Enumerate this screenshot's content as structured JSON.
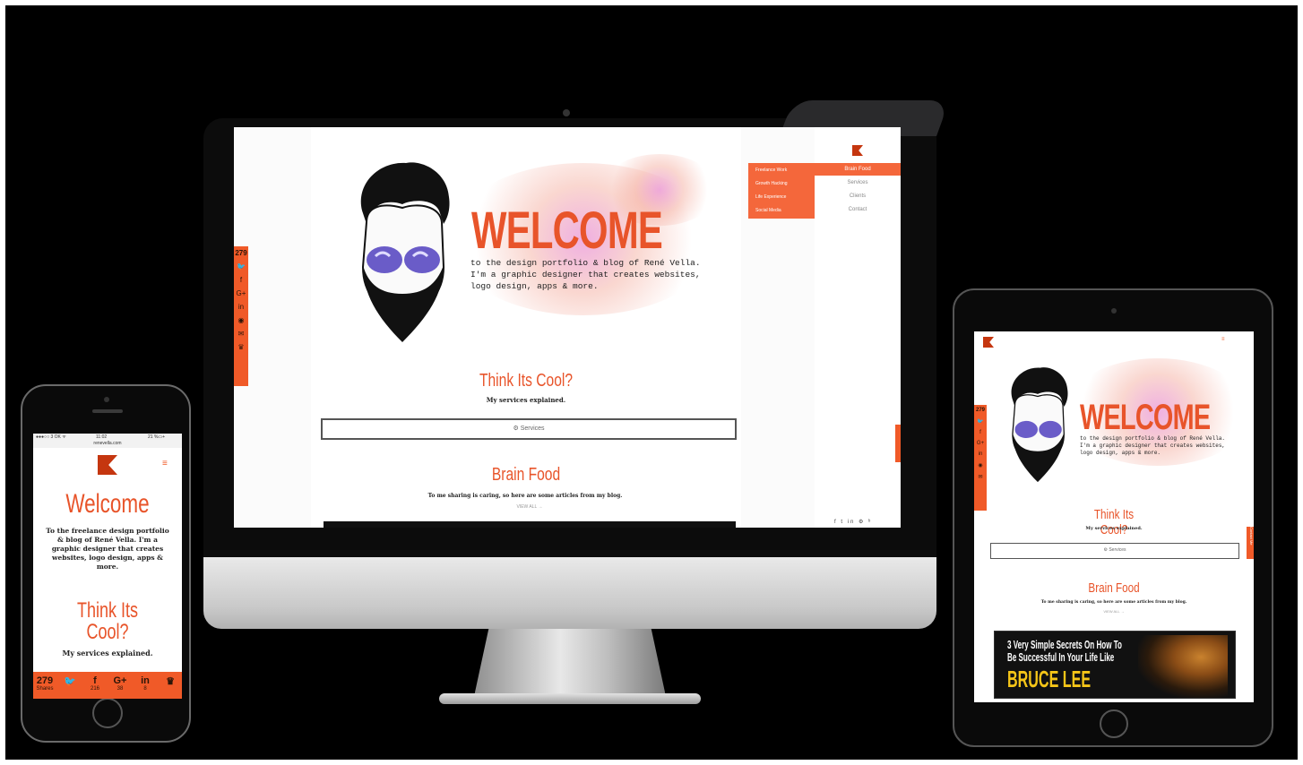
{
  "colors": {
    "accent": "#f05a28",
    "background": "#000000"
  },
  "site": {
    "welcome": "WELCOME",
    "intro_lines": [
      "to the design portfolio & blog of René Vella.",
      "I'm a graphic designer that creates websites,",
      "logo design, apps & more."
    ],
    "think": "Think Its Cool?",
    "explained": "My services explained.",
    "services_btn": "Services",
    "brain": "Brain Food",
    "sharing": "To me sharing is caring, so here are some articles from my blog.",
    "view_all": "VIEW ALL →",
    "share_count": "279",
    "share_label": "Shares",
    "contact_tab": "Contact Me"
  },
  "desktop_nav": {
    "items": [
      "Brain Food",
      "Services",
      "Clients",
      "Contact"
    ],
    "submenu": [
      "Freelance Work",
      "Growth Hacking",
      "Life Experience",
      "Social Media"
    ],
    "social_icons": "f  t  in  ⚙  ᵇ"
  },
  "phone": {
    "status_left": "●●●○○ 3 OK ᯤ",
    "status_time": "11:02",
    "status_right": "21 %▭+",
    "url": "renevella.com",
    "menu_icon": "≡",
    "welcome": "Welcome",
    "intro": "To the freelance design portfolio & blog of René Vella. I'm a graphic designer that creates websites, logo design, apps & more.",
    "think": "Think Its Cool?",
    "explained": "My services explained.",
    "share_count": "279",
    "share_label": "Shares",
    "icons": [
      {
        "glyph": "🐦",
        "count": ""
      },
      {
        "glyph": "f",
        "count": "216"
      },
      {
        "glyph": "G+",
        "count": "38"
      },
      {
        "glyph": "in",
        "count": "8"
      },
      {
        "glyph": "♛",
        "count": ""
      }
    ]
  },
  "tablet": {
    "menu_icon": "≡",
    "banner_line1": "3 Very Simple Secrets On How To",
    "banner_line2": "Be Successful In Your Life Like",
    "banner_line3": "BRUCE LEE"
  }
}
